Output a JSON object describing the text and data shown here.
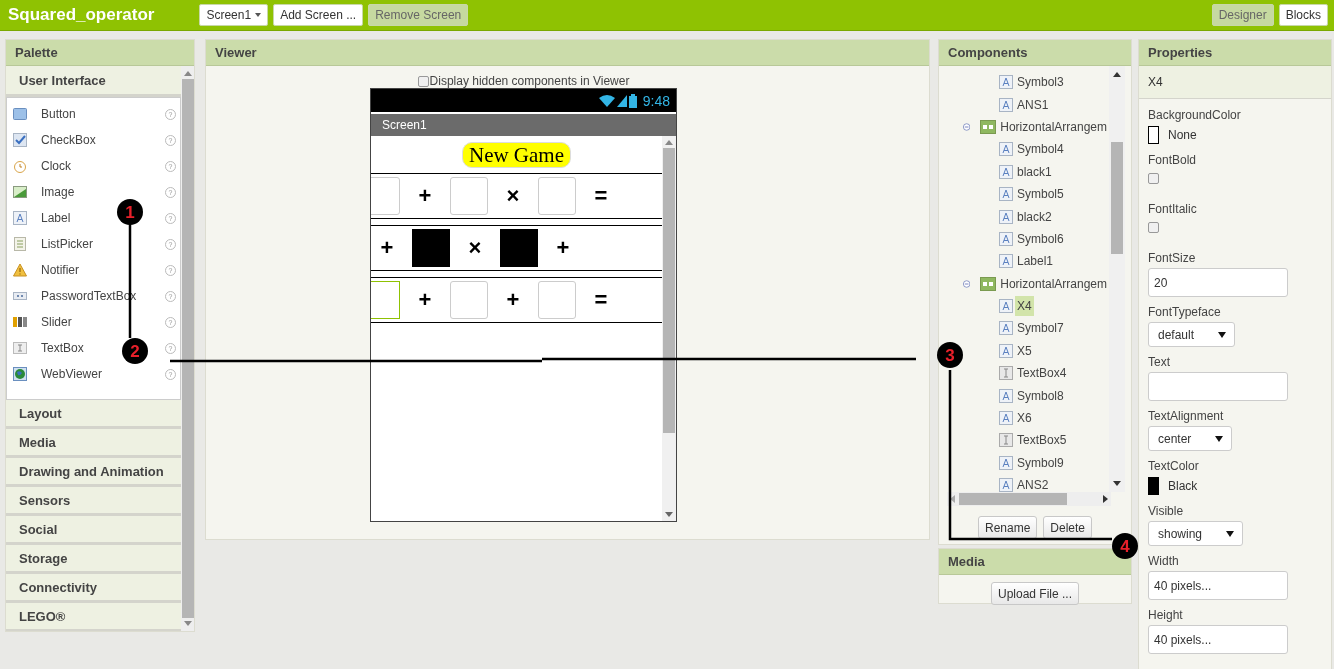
{
  "topbar": {
    "title": "Squared_operator",
    "screen_menu": "Screen1",
    "add_screen": "Add Screen ...",
    "remove_screen": {
      "label": "Remove Screen",
      "disabled": true
    },
    "modes": [
      {
        "label": "Designer",
        "selected": true
      },
      {
        "label": "Blocks",
        "selected": false
      }
    ]
  },
  "palette": {
    "title": "Palette",
    "open_section": "User Interface",
    "items": [
      {
        "label": "Button",
        "help": "?"
      },
      {
        "label": "CheckBox",
        "help": "?"
      },
      {
        "label": "Clock",
        "help": "?"
      },
      {
        "label": "Image",
        "help": "?"
      },
      {
        "label": "Label",
        "help": "?"
      },
      {
        "label": "ListPicker",
        "help": "?"
      },
      {
        "label": "Notifier",
        "help": "?"
      },
      {
        "label": "PasswordTextBox",
        "help": "?"
      },
      {
        "label": "Slider",
        "help": "?"
      },
      {
        "label": "TextBox",
        "help": "?"
      },
      {
        "label": "WebViewer",
        "help": "?"
      }
    ],
    "sections": [
      "Layout",
      "Media",
      "Drawing and Animation",
      "Sensors",
      "Social",
      "Storage",
      "Connectivity",
      "LEGO®"
    ]
  },
  "viewer": {
    "title": "Viewer",
    "hidden_checkbox": {
      "label": "Display hidden components in Viewer",
      "checked": false
    },
    "phone": {
      "time": "9:48",
      "screen_title": "Screen1",
      "button": "New Game",
      "rows": [
        [
          {
            "kind": "textbox",
            "selected": false
          },
          {
            "kind": "symbol",
            "text": "+"
          },
          {
            "kind": "textbox",
            "selected": false
          },
          {
            "kind": "symbol",
            "text": "×"
          },
          {
            "kind": "textbox",
            "selected": false
          },
          {
            "kind": "symbol",
            "text": "="
          }
        ],
        [
          {
            "kind": "symbol",
            "text": "+"
          },
          {
            "kind": "black"
          },
          {
            "kind": "symbol",
            "text": "×"
          },
          {
            "kind": "black"
          },
          {
            "kind": "symbol",
            "text": "+"
          }
        ],
        [
          {
            "kind": "textbox",
            "selected": true
          },
          {
            "kind": "symbol",
            "text": "+"
          },
          {
            "kind": "textbox",
            "selected": false
          },
          {
            "kind": "symbol",
            "text": "+"
          },
          {
            "kind": "textbox",
            "selected": false
          },
          {
            "kind": "symbol",
            "text": "="
          }
        ]
      ]
    }
  },
  "components": {
    "title": "Components",
    "continued": [
      {
        "name": "Symbol3",
        "kind": "label",
        "selected": false
      },
      {
        "name": "ANS1",
        "kind": "label",
        "selected": false
      }
    ],
    "nodes": [
      {
        "name": "HorizontalArrangem",
        "kind": "arrangement",
        "expanded": true,
        "children": [
          {
            "name": "Symbol4",
            "kind": "label",
            "selected": false
          },
          {
            "name": "black1",
            "kind": "label",
            "selected": false
          },
          {
            "name": "Symbol5",
            "kind": "label",
            "selected": false
          },
          {
            "name": "black2",
            "kind": "label",
            "selected": false
          },
          {
            "name": "Symbol6",
            "kind": "label",
            "selected": false
          },
          {
            "name": "Label1",
            "kind": "label",
            "selected": false
          }
        ]
      },
      {
        "name": "HorizontalArrangem",
        "kind": "arrangement",
        "expanded": true,
        "children": [
          {
            "name": "X4",
            "kind": "label",
            "selected": true
          },
          {
            "name": "Symbol7",
            "kind": "label",
            "selected": false
          },
          {
            "name": "X5",
            "kind": "label",
            "selected": false
          },
          {
            "name": "TextBox4",
            "kind": "textbox",
            "selected": false
          },
          {
            "name": "Symbol8",
            "kind": "label",
            "selected": false
          },
          {
            "name": "X6",
            "kind": "label",
            "selected": false
          },
          {
            "name": "TextBox5",
            "kind": "textbox",
            "selected": false
          },
          {
            "name": "Symbol9",
            "kind": "label",
            "selected": false
          },
          {
            "name": "ANS2",
            "kind": "label",
            "selected": false
          }
        ]
      }
    ],
    "buttons": [
      "Rename",
      "Delete"
    ]
  },
  "media": {
    "title": "Media",
    "button": "Upload File ..."
  },
  "properties": {
    "title": "Properties",
    "component": "X4",
    "items": [
      {
        "label": "BackgroundColor",
        "kind": "color",
        "value": "None",
        "color": "#ffffff"
      },
      {
        "label": "FontBold",
        "kind": "checkbox",
        "checked": false
      },
      {
        "label": "FontItalic",
        "kind": "checkbox",
        "checked": false
      },
      {
        "label": "FontSize",
        "kind": "text",
        "value": "20"
      },
      {
        "label": "FontTypeface",
        "kind": "dropdown",
        "value": "default"
      },
      {
        "label": "Text",
        "kind": "text"
      },
      {
        "label": "TextAlignment",
        "kind": "dropdown",
        "value": "center"
      },
      {
        "label": "TextColor",
        "kind": "color",
        "value": "Black",
        "color": "#000000"
      },
      {
        "label": "Visible",
        "kind": "dropdown",
        "value": "showing"
      },
      {
        "label": "Width",
        "kind": "text",
        "value": "40 pixels..."
      },
      {
        "label": "Height",
        "kind": "text",
        "value": "40 pixels..."
      }
    ]
  },
  "annotations": [
    {
      "label": "1"
    },
    {
      "label": "2"
    },
    {
      "label": "3"
    },
    {
      "label": "4"
    }
  ]
}
